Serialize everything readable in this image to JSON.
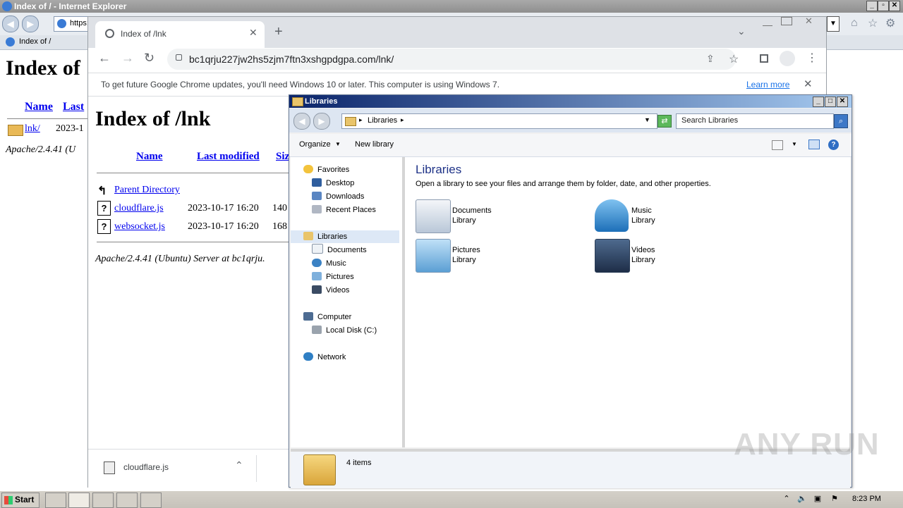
{
  "ie": {
    "title": "Index of / - Internet Explorer",
    "address_partial": "https:",
    "tab_label": "Index of /",
    "page": {
      "heading": "Index of",
      "col_name": "Name",
      "col_last": "Last",
      "row_name": "lnk/",
      "row_date": "2023-1",
      "footer": "Apache/2.4.41 (U"
    }
  },
  "chrome": {
    "tab_title": "Index of /lnk",
    "url": "bc1qrju227jw2hs5zjm7ftn3xshgpdgpa.com/lnk/",
    "infobar_text": "To get future Google Chrome updates, you'll need Windows 10 or later. This computer is using Windows 7.",
    "infobar_link": "Learn more",
    "page": {
      "heading": "Index of /lnk",
      "col_name": "Name",
      "col_modified": "Last modified",
      "col_size": "Siz",
      "parent": "Parent Directory",
      "rows": [
        {
          "name": "cloudflare.js",
          "date": "2023-10-17 16:20",
          "size": "140"
        },
        {
          "name": "websocket.js",
          "date": "2023-10-17 16:20",
          "size": "168"
        }
      ],
      "footer": "Apache/2.4.41 (Ubuntu) Server at bc1qrju."
    },
    "download_file": "cloudflare.js"
  },
  "explorer": {
    "title": "Libraries",
    "breadcrumb": "Libraries",
    "search_placeholder": "Search Libraries",
    "organize": "Organize",
    "new_library": "New library",
    "nav": {
      "favorites": "Favorites",
      "desktop": "Desktop",
      "downloads": "Downloads",
      "recent": "Recent Places",
      "libraries": "Libraries",
      "documents": "Documents",
      "music": "Music",
      "pictures": "Pictures",
      "videos": "Videos",
      "computer": "Computer",
      "local_disk": "Local Disk (C:)",
      "network": "Network"
    },
    "main_title": "Libraries",
    "main_subtitle": "Open a library to see your files and arrange them by folder, date, and other properties.",
    "libraries": [
      {
        "name": "Documents",
        "type": "Library"
      },
      {
        "name": "Music",
        "type": "Library"
      },
      {
        "name": "Pictures",
        "type": "Library"
      },
      {
        "name": "Videos",
        "type": "Library"
      }
    ],
    "status": "4 items"
  },
  "taskbar": {
    "start": "Start",
    "clock": "8:23 PM"
  },
  "watermark": "ANY RUN"
}
